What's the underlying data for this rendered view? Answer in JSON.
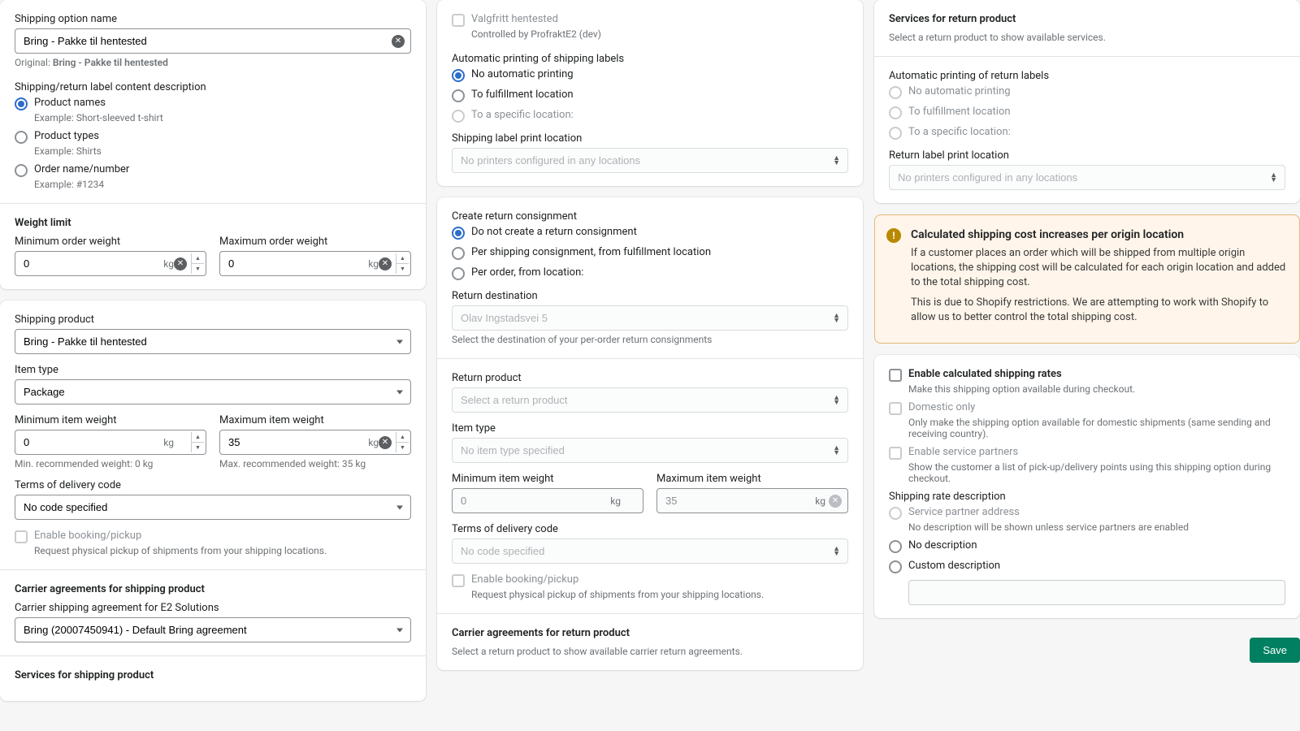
{
  "col1": {
    "name_label": "Shipping option name",
    "name_value": "Bring - Pakke til hentested",
    "original_prefix": "Original: ",
    "original_value": "Bring - Pakke til hentested",
    "content_label": "Shipping/return label content description",
    "content_options": [
      {
        "label": "Product names",
        "example": "Example: Short-sleeved t-shirt",
        "checked": true
      },
      {
        "label": "Product types",
        "example": "Example: Shirts",
        "checked": false
      },
      {
        "label": "Order name/number",
        "example": "Example: #1234",
        "checked": false
      }
    ],
    "weight_title": "Weight limit",
    "min_order_label": "Minimum order weight",
    "max_order_label": "Maximum order weight",
    "min_order_value": "0",
    "max_order_value": "0",
    "kg": "kg",
    "shipping_product_label": "Shipping product",
    "shipping_product_value": "Bring - Pakke til hentested",
    "item_type_label": "Item type",
    "item_type_value": "Package",
    "min_item_label": "Minimum item weight",
    "max_item_label": "Maximum item weight",
    "min_item_value": "0",
    "max_item_value": "35",
    "min_rec": "Min. recommended weight: 0 kg",
    "max_rec": "Max. recommended weight: 35 kg",
    "terms_label": "Terms of delivery code",
    "terms_value": "No code specified",
    "enable_booking": "Enable booking/pickup",
    "enable_booking_help": "Request physical pickup of shipments from your shipping locations.",
    "carrier_title": "Carrier agreements for shipping product",
    "carrier_sub": "Carrier shipping agreement for E2 Solutions",
    "carrier_value": "Bring (20007450941) - Default Bring agreement",
    "services_title": "Services for shipping product"
  },
  "col2": {
    "valgfritt": "Valgfritt hentested",
    "valgfritt_help": "Controlled by ProfraktE2 (dev)",
    "auto_print_label": "Automatic printing of shipping labels",
    "auto_print_options": [
      {
        "label": "No automatic printing",
        "checked": true,
        "disabled": false
      },
      {
        "label": "To fulfillment location",
        "checked": false,
        "disabled": false
      },
      {
        "label": "To a specific location:",
        "checked": false,
        "disabled": true
      }
    ],
    "print_loc_label": "Shipping label print location",
    "print_loc_value": "No printers configured in any locations",
    "create_return_label": "Create return consignment",
    "create_return_options": [
      {
        "label": "Do not create a return consignment",
        "checked": true
      },
      {
        "label": "Per shipping consignment, from fulfillment location",
        "checked": false
      },
      {
        "label": "Per order, from location:",
        "checked": false
      }
    ],
    "return_dest_label": "Return destination",
    "return_dest_value": "Olav Ingstadsvei 5",
    "return_dest_help": "Select the destination of your per-order return consignments",
    "return_product_label": "Return product",
    "return_product_value": "Select a return product",
    "ritem_type_label": "Item type",
    "ritem_type_value": "No item type specified",
    "rmin_label": "Minimum item weight",
    "rmax_label": "Maximum item weight",
    "rmin_value": "0",
    "rmax_value": "35",
    "rterms_label": "Terms of delivery code",
    "rterms_value": "No code specified",
    "r_enable_booking": "Enable booking/pickup",
    "r_enable_booking_help": "Request physical pickup of shipments from your shipping locations.",
    "rcarrier_title": "Carrier agreements for return product",
    "rcarrier_help": "Select a return product to show available carrier return agreements."
  },
  "col3": {
    "services_title": "Services for return product",
    "services_help": "Select a return product to show available services.",
    "auto_print_label": "Automatic printing of return labels",
    "auto_print_options": [
      {
        "label": "No automatic printing"
      },
      {
        "label": "To fulfillment location"
      },
      {
        "label": "To a specific location:"
      }
    ],
    "print_loc_label": "Return label print location",
    "print_loc_value": "No printers configured in any locations",
    "banner_title": "Calculated shipping cost increases per origin location",
    "banner_p1": "If a customer places an order which will be shipped from multiple origin locations, the shipping cost will be calculated for each origin location and added to the total shipping cost.",
    "banner_p2": "This is due to Shopify restrictions. We are attempting to work with Shopify to allow us to better control the total shipping cost.",
    "enable_calc": "Enable calculated shipping rates",
    "enable_calc_help": "Make this shipping option available during checkout.",
    "domestic": "Domestic only",
    "domestic_help": "Only make the shipping option available for domestic shipments (same sending and receiving country).",
    "partners": "Enable service partners",
    "partners_help": "Show the customer a list of pick-up/delivery points using this shipping option during checkout.",
    "rate_desc_label": "Shipping rate description",
    "rate_opts": [
      {
        "label": "Service partner address",
        "help": "No description will be shown unless service partners are enabled",
        "disabled": true
      },
      {
        "label": "No description",
        "disabled": false
      },
      {
        "label": "Custom description",
        "disabled": false
      }
    ],
    "save": "Save"
  }
}
